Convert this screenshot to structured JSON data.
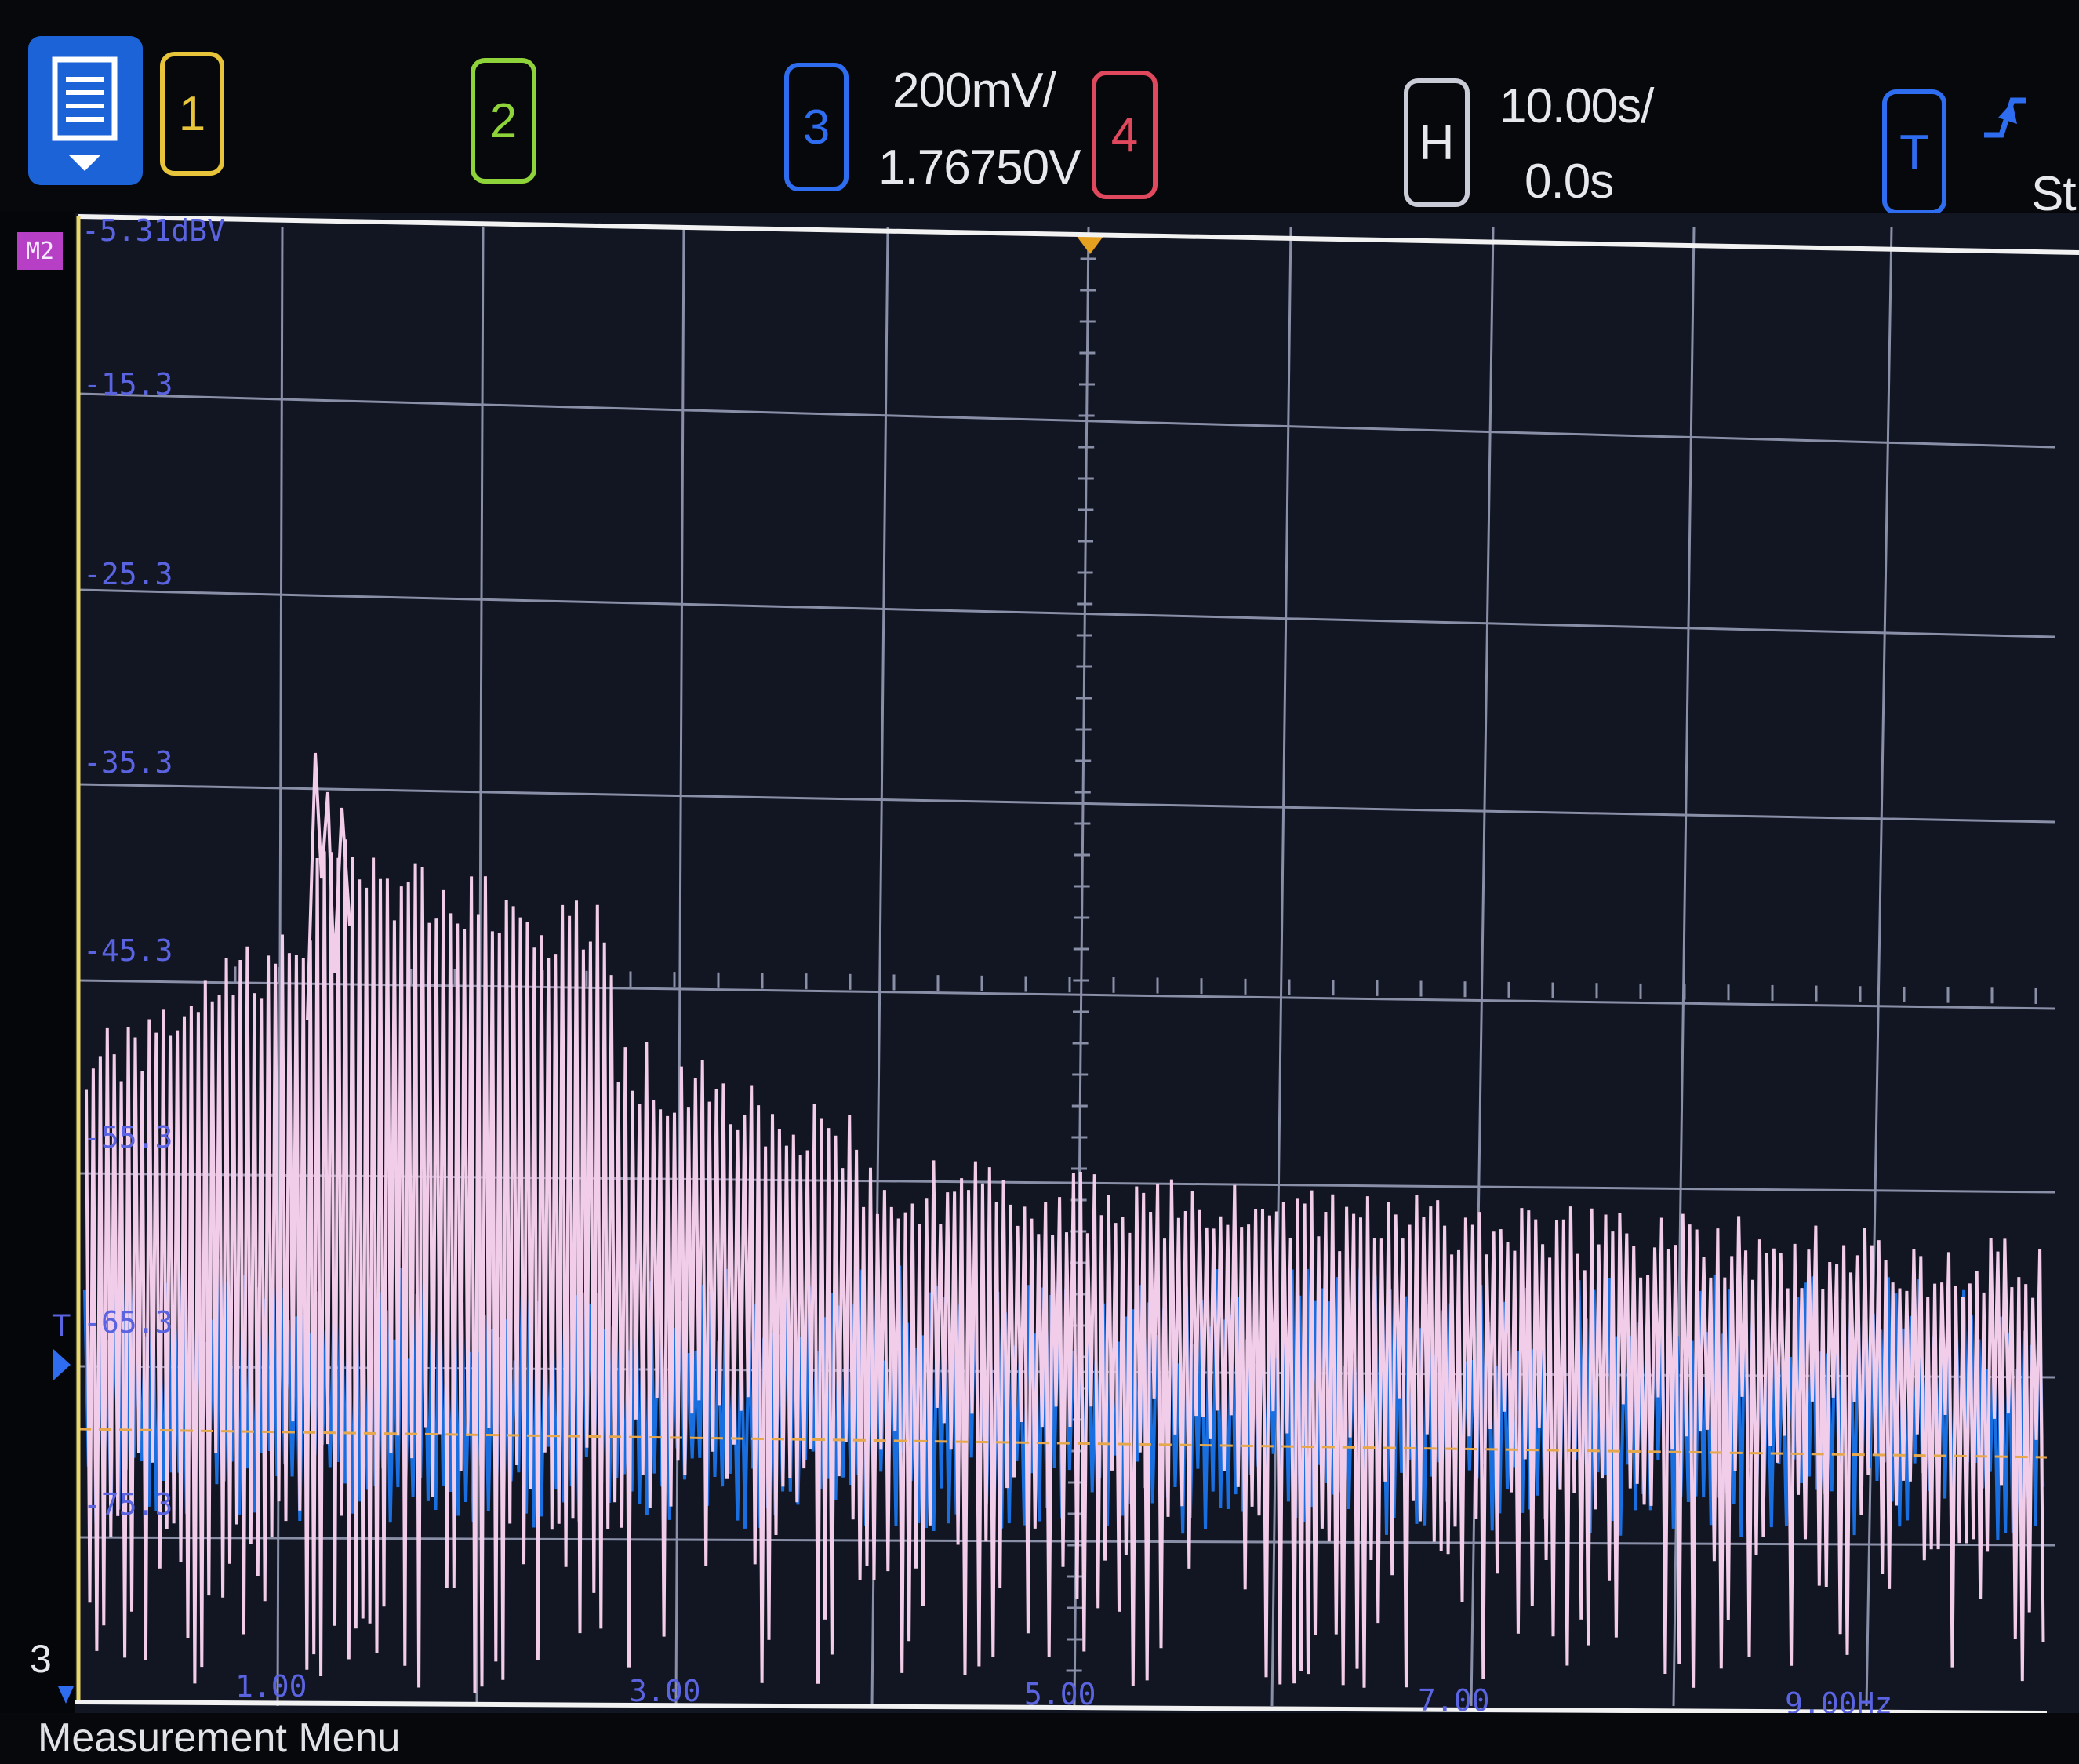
{
  "menu_icon": "menu-list-icon",
  "channels": [
    {
      "label": "1",
      "color": "#e7c43a"
    },
    {
      "label": "2",
      "color": "#8fd33a"
    },
    {
      "label": "3",
      "color": "#2f6df0"
    },
    {
      "label": "4",
      "color": "#e0485e"
    }
  ],
  "ch3_scale": "200mV/",
  "ch3_offset": "1.76750V",
  "horizontal": {
    "label": "H",
    "scale": "10.00s/",
    "delay": "0.0s"
  },
  "trigger": {
    "label": "T",
    "icon": "trigger-edge-icon",
    "status": "St"
  },
  "math": {
    "tag": "M2",
    "top_level": "-5.31dBV"
  },
  "y_labels": [
    "-15.3",
    "-25.3",
    "-35.3",
    "-45.3",
    "-55.3",
    "-65.3",
    "-75.3"
  ],
  "x_labels": [
    "1.00",
    "3.00",
    "5.00",
    "7.00",
    "9.00Hz"
  ],
  "ch3_marker": "3",
  "trig_marker": "T",
  "footer": "Measurement Menu",
  "colors": {
    "math_trace": "#f1cdea",
    "ch3_trace": "#1a6fe0",
    "grid": "#8a8fa8",
    "axis_labels": "#5a63e0"
  }
}
